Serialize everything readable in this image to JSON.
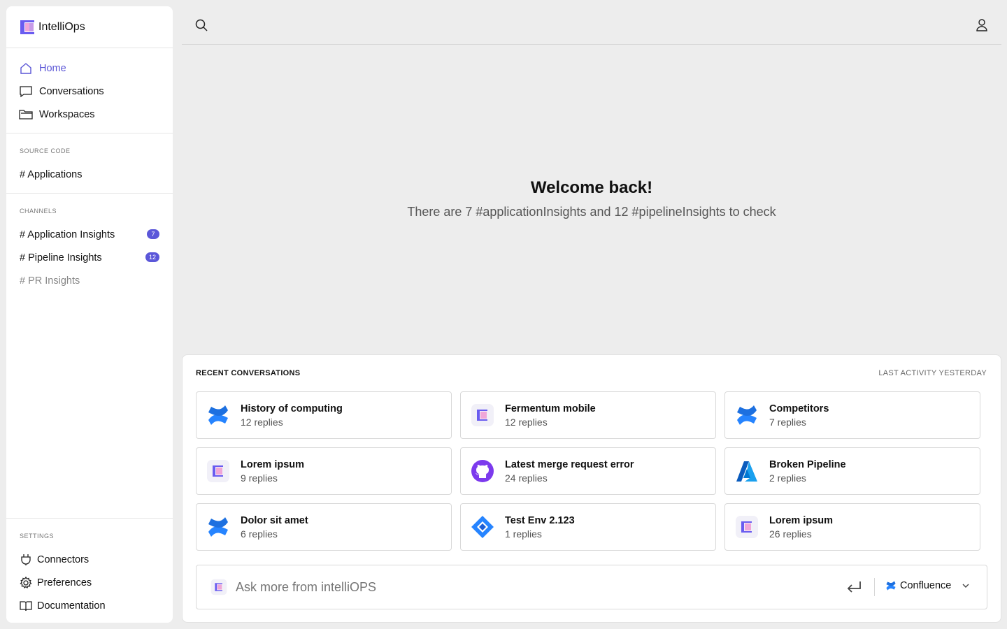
{
  "brand": {
    "name": "IntelliOps"
  },
  "nav": {
    "items": [
      {
        "label": "Home",
        "icon": "home-icon",
        "active": true
      },
      {
        "label": "Conversations",
        "icon": "chat-icon"
      },
      {
        "label": "Workspaces",
        "icon": "folder-icon"
      }
    ]
  },
  "source_code": {
    "title": "SOURCE CODE",
    "items": [
      {
        "label": "# Applications"
      }
    ]
  },
  "channels": {
    "title": "CHANNELS",
    "items": [
      {
        "label": "# Application Insights",
        "badge": "7"
      },
      {
        "label": "# Pipeline Insights",
        "badge": "12"
      },
      {
        "label": "# PR Insights"
      }
    ]
  },
  "settings": {
    "title": "SETTINGS",
    "items": [
      {
        "label": "Connectors",
        "icon": "plug-icon"
      },
      {
        "label": "Preferences",
        "icon": "gear-icon"
      },
      {
        "label": "Documentation",
        "icon": "book-icon"
      }
    ]
  },
  "welcome": {
    "title": "Welcome back!",
    "subtitle": "There are 7 #applicationInsights and 12 #pipelineInsights to check"
  },
  "recent": {
    "title": "RECENT CONVERSATIONS",
    "last_activity": "LAST ACTIVITY YESTERDAY",
    "cards": [
      {
        "title": "History of computing",
        "replies": "12 replies",
        "icon": "confluence-icon"
      },
      {
        "title": "Fermentum mobile",
        "replies": "12 replies",
        "icon": "intelliops-icon"
      },
      {
        "title": "Competitors",
        "replies": "7 replies",
        "icon": "confluence-icon"
      },
      {
        "title": "Lorem ipsum",
        "replies": "9 replies",
        "icon": "intelliops-icon"
      },
      {
        "title": "Latest merge request error",
        "replies": "24 replies",
        "icon": "github-icon"
      },
      {
        "title": "Broken Pipeline",
        "replies": "2 replies",
        "icon": "azure-icon"
      },
      {
        "title": "Dolor sit amet",
        "replies": "6 replies",
        "icon": "confluence-icon"
      },
      {
        "title": "Test Env 2.123",
        "replies": "1 replies",
        "icon": "jira-icon"
      },
      {
        "title": "Lorem ipsum",
        "replies": "26 replies",
        "icon": "intelliops-icon"
      }
    ]
  },
  "ask": {
    "placeholder": "Ask more from intelliOPS",
    "source": "Confluence"
  },
  "colors": {
    "accent": "#5b57d9",
    "confluence": "#2684ff",
    "github": "#7c3aed",
    "azure": "#0078d4"
  }
}
